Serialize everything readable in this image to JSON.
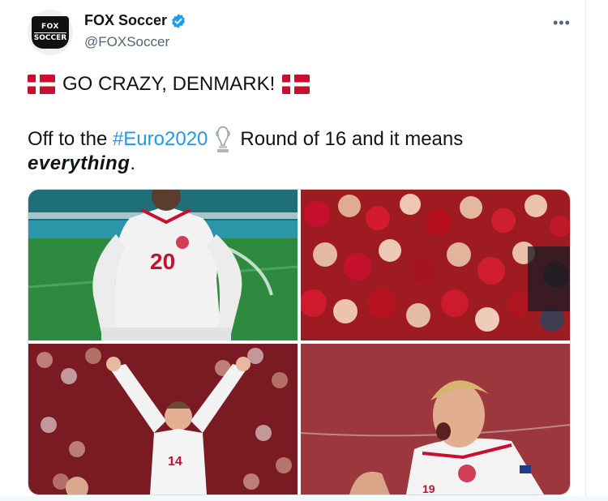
{
  "tweet": {
    "avatar_text_top": "FOX",
    "avatar_text_bottom": "SOCCER",
    "display_name": "FOX Soccer",
    "handle": "@FOXSoccer",
    "more_label": "•••",
    "line1": "GO CRAZY, DENMARK!",
    "line2_prefix": "Off to the ",
    "hashtag": "#Euro2020",
    "line2_suffix": "Round of 16 and it means",
    "line3_emphasis": "everything",
    "line3_suffix": ".",
    "player_numbers": [
      "20",
      "14",
      "19"
    ]
  },
  "colors": {
    "link": "#1d9bf0",
    "verified": "#1d9bf0",
    "denmark_red": "#c8102e"
  }
}
